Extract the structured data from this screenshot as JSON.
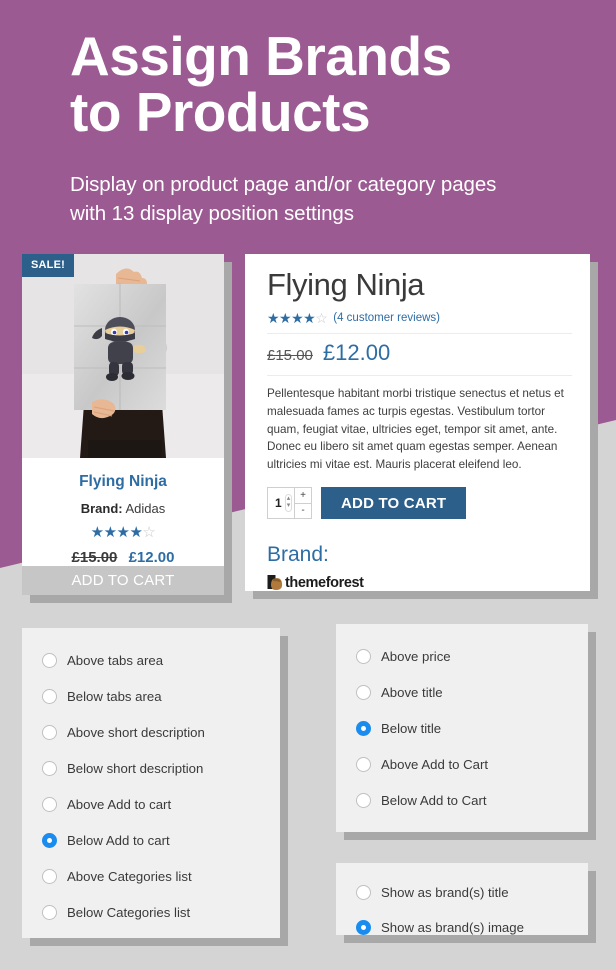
{
  "theme": {
    "purple": "#9b5a91",
    "page_bg": "#d4d4d4",
    "panel_bg": "#f0f0f0",
    "accent_blue": "#2e6da4",
    "button_blue": "#2c5f8a",
    "radio_selected": "#1a8cf0"
  },
  "hero": {
    "title": "Assign Brands\nto Products",
    "subtitle": "Display on product page and/or category pages\nwith 13 display position settings"
  },
  "product_card": {
    "sale_badge": "SALE!",
    "title": "Flying Ninja",
    "brand_label": "Brand:",
    "brand_value": "Adidas",
    "rating_filled": 4,
    "rating_total": 5,
    "old_price": "£15.00",
    "new_price": "£12.00",
    "add_to_cart": "ADD TO CART",
    "image_alt": "person holding ninja poster"
  },
  "product_detail": {
    "title": "Flying Ninja",
    "rating_filled": 4,
    "rating_total": 5,
    "reviews_text": "(4 customer reviews)",
    "old_price": "£15.00",
    "new_price": "£12.00",
    "description": "Pellentesque habitant morbi tristique senectus et netus et malesuada fames ac turpis egestas. Vestibulum tortor quam, feugiat vitae, ultricies eget, tempor sit amet, ante. Donec eu libero sit amet quam egestas semper. Aenean ultricies mi vitae est. Mauris placerat eleifend leo.",
    "quantity": "1",
    "qty_increase": "+",
    "qty_decrease": "-",
    "add_to_cart": "ADD TO CART",
    "brand_heading": "Brand:",
    "brand_logo_text": "themeforest"
  },
  "panels": {
    "product_positions": {
      "options": [
        {
          "label": "Above tabs area",
          "selected": false
        },
        {
          "label": "Below tabs area",
          "selected": false
        },
        {
          "label": "Above short description",
          "selected": false
        },
        {
          "label": "Below short description",
          "selected": false
        },
        {
          "label": "Above Add to cart",
          "selected": false
        },
        {
          "label": "Below Add to cart",
          "selected": true
        },
        {
          "label": "Above Categories list",
          "selected": false
        },
        {
          "label": "Below Categories list",
          "selected": false
        }
      ]
    },
    "category_positions": {
      "options": [
        {
          "label": "Above price",
          "selected": false
        },
        {
          "label": "Above title",
          "selected": false
        },
        {
          "label": "Below title",
          "selected": true
        },
        {
          "label": "Above Add to Cart",
          "selected": false
        },
        {
          "label": "Below Add to Cart",
          "selected": false
        }
      ]
    },
    "display_mode": {
      "options": [
        {
          "label": "Show as brand(s) title",
          "selected": false
        },
        {
          "label": "Show as brand(s) image",
          "selected": true
        }
      ]
    }
  }
}
